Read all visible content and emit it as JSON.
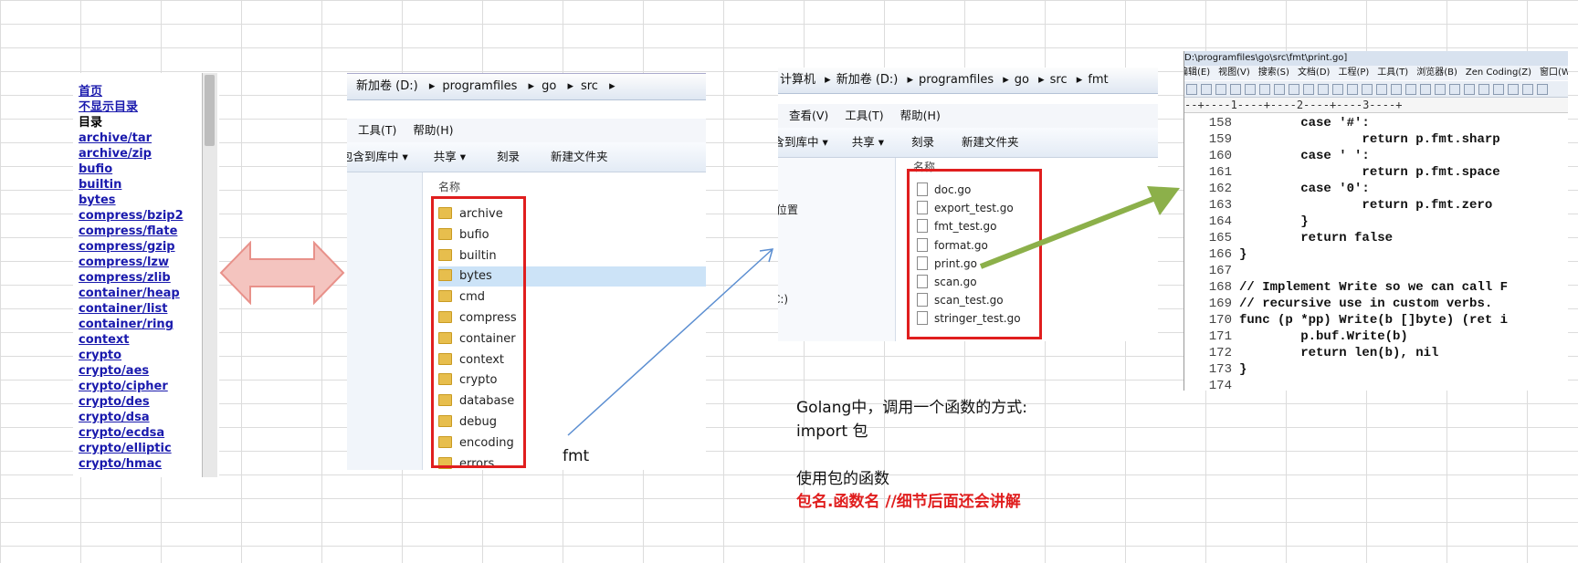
{
  "packages": [
    "首页",
    "不显示目录",
    "目录",
    "archive/tar",
    "archive/zip",
    "bufio",
    "builtin",
    "bytes",
    "compress/bzip2",
    "compress/flate",
    "compress/gzip",
    "compress/lzw",
    "compress/zlib",
    "container/heap",
    "container/list",
    "container/ring",
    "context",
    "crypto",
    "crypto/aes",
    "crypto/cipher",
    "crypto/des",
    "crypto/dsa",
    "crypto/ecdsa",
    "crypto/elliptic",
    "crypto/hmac"
  ],
  "explorer1": {
    "breadcrumb": [
      "新加卷 (D:)",
      "programfiles",
      "go",
      "src"
    ],
    "menu": [
      "工具(T)",
      "帮助(H)"
    ],
    "toolbar": [
      "包含到库中 ▾",
      "共享 ▾",
      "刻录",
      "新建文件夹"
    ],
    "column_header": "名称",
    "folders": [
      "archive",
      "bufio",
      "builtin",
      "bytes",
      "cmd",
      "compress",
      "container",
      "context",
      "crypto",
      "database",
      "debug",
      "encoding",
      "errors"
    ],
    "selected_folder": "bytes"
  },
  "arrow_label": "fmt",
  "explorer2": {
    "breadcrumb": [
      "计算机",
      "新加卷 (D:)",
      "programfiles",
      "go",
      "src",
      "fmt"
    ],
    "menu": [
      "查看(V)",
      "工具(T)",
      "帮助(H)"
    ],
    "toolbar": [
      "包含到库中 ▾",
      "共享 ▾",
      "刻录",
      "新建文件夹"
    ],
    "column_header": "名称",
    "nav_items": [
      "的位置",
      "C:)"
    ],
    "files": [
      "doc.go",
      "export_test.go",
      "fmt_test.go",
      "format.go",
      "print.go",
      "scan.go",
      "scan_test.go",
      "stringer_test.go"
    ]
  },
  "editor": {
    "title": "D:\\programfiles\\go\\src\\fmt\\print.go]",
    "menu": [
      "编辑(E)",
      "视图(V)",
      "搜索(S)",
      "文档(D)",
      "工程(P)",
      "工具(T)",
      "浏览器(B)",
      "Zen Coding(Z)",
      "窗口(W)"
    ],
    "ruler": "--+----1----+----2----+----3----+",
    "lines": [
      {
        "n": "158",
        "t": "        case '#':"
      },
      {
        "n": "159",
        "t": "                return p.fmt.sharp"
      },
      {
        "n": "160",
        "t": "        case ' ':"
      },
      {
        "n": "161",
        "t": "                return p.fmt.space"
      },
      {
        "n": "162",
        "t": "        case '0':"
      },
      {
        "n": "163",
        "t": "                return p.fmt.zero"
      },
      {
        "n": "164",
        "t": "        }"
      },
      {
        "n": "165",
        "t": "        return false"
      },
      {
        "n": "166",
        "t": "}"
      },
      {
        "n": "167",
        "t": ""
      },
      {
        "n": "168",
        "t": "// Implement Write so we can call F"
      },
      {
        "n": "169",
        "t": "// recursive use in custom verbs."
      },
      {
        "n": "170",
        "t": "func (p *pp) Write(b []byte) (ret i"
      },
      {
        "n": "171",
        "t": "        p.buf.Write(b)"
      },
      {
        "n": "172",
        "t": "        return len(b), nil"
      },
      {
        "n": "173",
        "t": "}"
      },
      {
        "n": "174",
        "t": ""
      }
    ]
  },
  "notes": {
    "line1": "Golang中，调用一个函数的方式:",
    "line2": "import 包",
    "line3": "使用包的函数",
    "line4": "包名.函数名 //细节后面还会讲解"
  },
  "colors": {
    "highlight_box": "#e01e1e",
    "double_arrow": "#f4c4bf",
    "green_arrow": "#8cb04a",
    "link": "#1a1aad"
  }
}
